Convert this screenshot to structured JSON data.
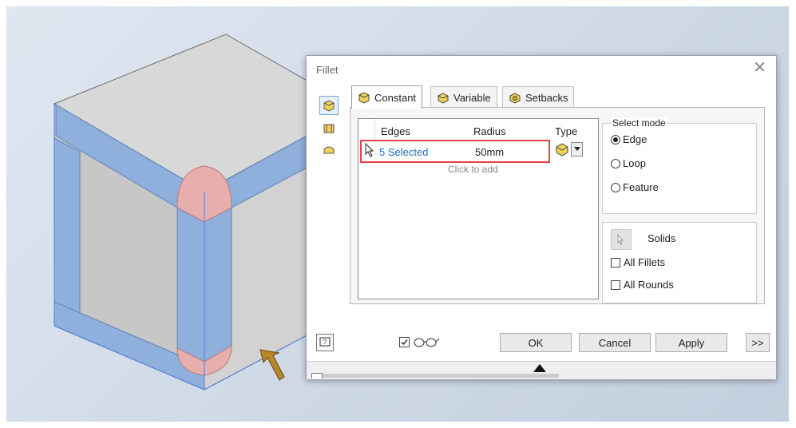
{
  "dialog": {
    "title": "Fillet",
    "close_glyph": "✕",
    "tabs": [
      {
        "label": "Constant",
        "icon": "constant-fillet-icon",
        "active": true
      },
      {
        "label": "Variable",
        "icon": "variable-fillet-icon",
        "active": false
      },
      {
        "label": "Setbacks",
        "icon": "setback-icon",
        "active": false
      }
    ],
    "table": {
      "headers": {
        "edges": "Edges",
        "radius": "Radius",
        "type": "Type"
      },
      "rows": [
        {
          "edges": "5 Selected",
          "radius": "50mm"
        }
      ],
      "placeholder": "Click to add"
    },
    "select_mode": {
      "label": "Select mode",
      "options": [
        {
          "label": "Edge",
          "selected": true
        },
        {
          "label": "Loop",
          "selected": false
        },
        {
          "label": "Feature",
          "selected": false
        }
      ]
    },
    "solids_label": "Solids",
    "checkboxes": [
      {
        "label": "All Fillets",
        "checked": false
      },
      {
        "label": "All Rounds",
        "checked": false
      }
    ],
    "preview_checked": true,
    "buttons": {
      "ok": "OK",
      "cancel": "Cancel",
      "apply": "Apply",
      "more": ">>"
    }
  },
  "colors": {
    "fillet_highlight": "#8fb0dc",
    "corner_highlight": "#e8aeae",
    "selection_outline": "#e8414a",
    "link_text": "#1f6fc1",
    "arrow": "#b8862b"
  }
}
